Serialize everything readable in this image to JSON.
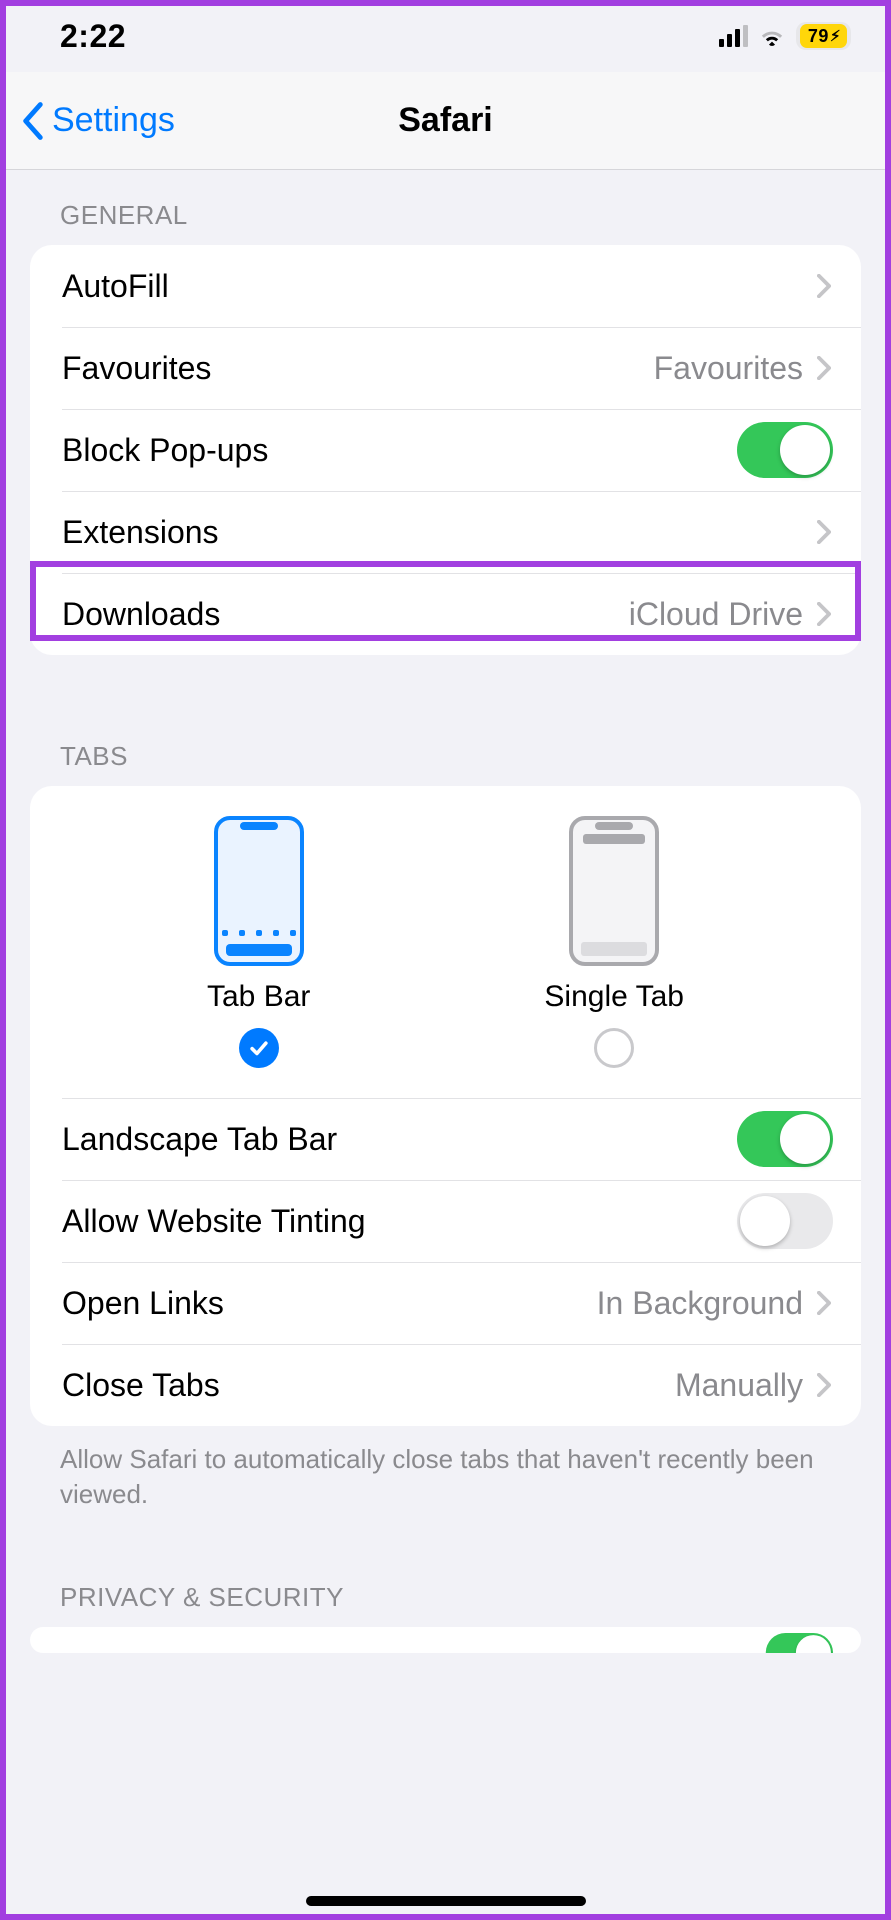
{
  "status": {
    "time": "2:22",
    "battery": "79"
  },
  "nav": {
    "back": "Settings",
    "title": "Safari"
  },
  "sections": {
    "general": {
      "header": "GENERAL",
      "autofill": "AutoFill",
      "favourites_label": "Favourites",
      "favourites_value": "Favourites",
      "block_popups": "Block Pop-ups",
      "block_popups_on": true,
      "extensions": "Extensions",
      "downloads_label": "Downloads",
      "downloads_value": "iCloud Drive"
    },
    "tabs": {
      "header": "TABS",
      "option_tabbar": "Tab Bar",
      "option_singletab": "Single Tab",
      "selected": "tabbar",
      "landscape": "Landscape Tab Bar",
      "landscape_on": true,
      "tinting": "Allow Website Tinting",
      "tinting_on": false,
      "open_links_label": "Open Links",
      "open_links_value": "In Background",
      "close_tabs_label": "Close Tabs",
      "close_tabs_value": "Manually",
      "footer": "Allow Safari to automatically close tabs that haven't recently been viewed."
    },
    "privacy": {
      "header": "PRIVACY & SECURITY"
    }
  }
}
